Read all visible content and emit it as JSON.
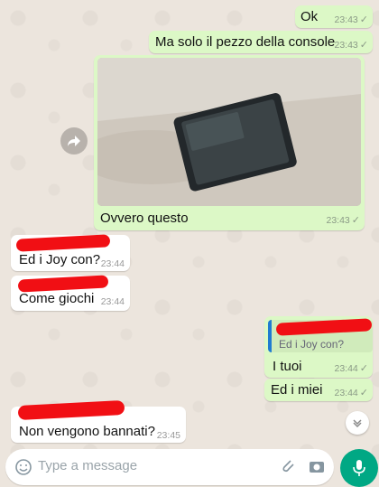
{
  "messages": [
    {
      "text": "Ok",
      "time": "23:43"
    },
    {
      "text": "Ma solo il pezzo della console",
      "time": "23:43"
    },
    {
      "text": "Ovvero questo",
      "time": "23:43"
    },
    {
      "text": "Ed i Joy con?",
      "time": "23:44"
    },
    {
      "text": "Come giochi",
      "time": "23:44"
    },
    {
      "reply_quote": "Ed i Joy con?",
      "text": "I tuoi",
      "time": "23:44"
    },
    {
      "text": "Ed i miei",
      "time": "23:44"
    },
    {
      "text": "Non vengono bannati?",
      "time": "23:45"
    }
  ],
  "read_tick": "✓",
  "composer": {
    "placeholder": "Type a message"
  },
  "colors": {
    "outgoing_bubble": "#dcf8c6",
    "incoming_bubble": "#ffffff",
    "redaction": "#f10f14",
    "quote_bar": "#1f7bd1",
    "mic_button": "#00a884"
  },
  "icons": [
    "forward-icon",
    "chevron-down-icon",
    "emoji-icon",
    "attach-icon",
    "camera-icon",
    "mic-icon"
  ]
}
